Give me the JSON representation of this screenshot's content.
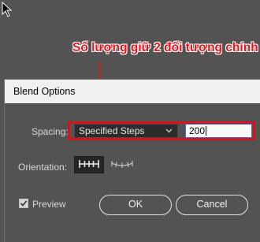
{
  "annotation": {
    "text": "Số lượng giữ 2 đối tượng chính"
  },
  "dialog": {
    "title": "Blend Options",
    "spacing": {
      "label": "Spacing:",
      "selected": "Specified Steps",
      "value": "200"
    },
    "orientation": {
      "label": "Orientation:"
    },
    "preview": {
      "label": "Preview",
      "checked": true
    },
    "buttons": {
      "ok": "OK",
      "cancel": "Cancel"
    }
  },
  "colors": {
    "dialog_bg": "#535353",
    "titlebar_bg": "#f0f0f0",
    "annotation": "#e8121a",
    "highlight_border": "#d9121a",
    "input_focus": "#3b6fd1"
  },
  "icons": [
    "cursor-icon",
    "arrow-down-icon",
    "chevron-down-icon",
    "align-to-page-icon",
    "align-to-path-icon",
    "checkmark-icon"
  ]
}
